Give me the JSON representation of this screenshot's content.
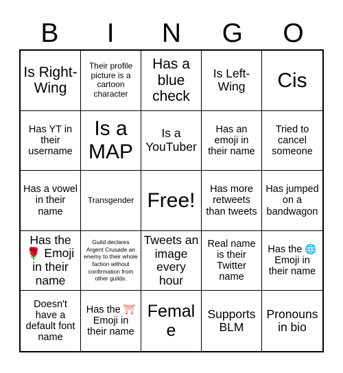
{
  "card": {
    "title_letters": [
      "B",
      "I",
      "N",
      "G",
      "O"
    ],
    "free_space_index": 12,
    "colors": {
      "background": "#ffffff",
      "border": "#000000",
      "text": "#000000",
      "rose_emoji": "#d22b2b",
      "globe_emoji": "#1d9bf0",
      "torii_emoji": "#e8462d"
    },
    "grid": {
      "columns": 5,
      "rows": 5
    },
    "cells": [
      {
        "row": 1,
        "col": 1,
        "text": "Is Right-Wing",
        "size": "lg"
      },
      {
        "row": 1,
        "col": 2,
        "text": "Their profile picture is a cartoon character",
        "size": "xs"
      },
      {
        "row": 1,
        "col": 3,
        "text": "Has a blue check",
        "size": "lg"
      },
      {
        "row": 1,
        "col": 4,
        "text": "Is Left-Wing",
        "size": "md"
      },
      {
        "row": 1,
        "col": 5,
        "text": "Cis",
        "size": "xxl"
      },
      {
        "row": 2,
        "col": 1,
        "text": "Has YT in their username",
        "size": "sm"
      },
      {
        "row": 2,
        "col": 2,
        "text": "Is a MAP",
        "size": "xxl"
      },
      {
        "row": 2,
        "col": 3,
        "text": "Is a YouTuber",
        "size": "md"
      },
      {
        "row": 2,
        "col": 4,
        "text": "Has an emoji in their name",
        "size": "sm"
      },
      {
        "row": 2,
        "col": 5,
        "text": "Tried to cancel someone",
        "size": "sm"
      },
      {
        "row": 3,
        "col": 1,
        "text": "Has a vowel in their name",
        "size": "sm"
      },
      {
        "row": 3,
        "col": 2,
        "text": "Transgender",
        "size": "xs"
      },
      {
        "row": 3,
        "col": 3,
        "text": "Free!",
        "size": "xxl",
        "free": true
      },
      {
        "row": 3,
        "col": 4,
        "text": "Has more retweets than tweets",
        "size": "sm"
      },
      {
        "row": 3,
        "col": 5,
        "text": "Has jumped on a bandwagon",
        "size": "sm"
      },
      {
        "row": 4,
        "col": 1,
        "text": "Has the 🌹 Emoji in their name",
        "size": "md",
        "emoji": "rose"
      },
      {
        "row": 4,
        "col": 2,
        "text": "Guild declares Argent Crusade an enemy to their whole faction without confirmation from other guilds.",
        "size": "xxs"
      },
      {
        "row": 4,
        "col": 3,
        "text": "Tweets an image every hour",
        "size": "md"
      },
      {
        "row": 4,
        "col": 4,
        "text": "Real name is their Twitter name",
        "size": "sm"
      },
      {
        "row": 4,
        "col": 5,
        "text": "Has the 🌐 Emoji in their name",
        "size": "sm",
        "emoji": "globe"
      },
      {
        "row": 5,
        "col": 1,
        "text": "Doesn't have a default font name",
        "size": "sm"
      },
      {
        "row": 5,
        "col": 2,
        "text": "Has the ⛩ Emoji in their name",
        "size": "sm",
        "emoji": "torii"
      },
      {
        "row": 5,
        "col": 3,
        "text": "Female",
        "size": "xl"
      },
      {
        "row": 5,
        "col": 4,
        "text": "Supports BLM",
        "size": "md"
      },
      {
        "row": 5,
        "col": 5,
        "text": "Pronouns in bio",
        "size": "md"
      }
    ]
  }
}
